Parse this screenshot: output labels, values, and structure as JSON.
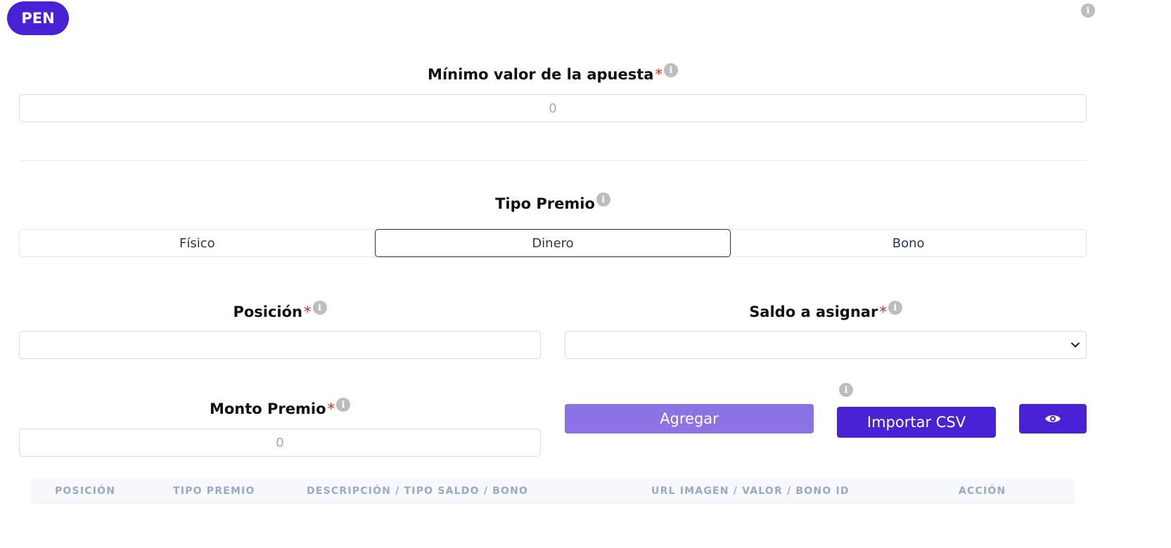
{
  "currency_badge": "PEN",
  "min_bet": {
    "label": "Mínimo valor de la apuesta",
    "required_mark": "*",
    "value_placeholder": "0"
  },
  "prize_type": {
    "label": "Tipo Premio",
    "options": [
      "Físico",
      "Dinero",
      "Bono"
    ],
    "selected": "Dinero"
  },
  "position": {
    "label": "Posición",
    "required_mark": "*",
    "value": ""
  },
  "balance": {
    "label": "Saldo a asignar",
    "required_mark": "*",
    "selected": ""
  },
  "prize_amount": {
    "label": "Monto Premio",
    "required_mark": "*",
    "value_placeholder": "0"
  },
  "actions": {
    "add_label": "Agregar",
    "import_label": "Importar CSV",
    "view_icon": "eye-icon"
  },
  "table": {
    "columns": [
      "POSICIÓN",
      "TIPO PREMIO",
      "DESCRIPCIÓN / TIPO SALDO / BONO",
      "URL IMAGEN / VALOR / BONO ID",
      "ACCIÓN"
    ]
  },
  "colors": {
    "primary": "#4a22d6",
    "primary_light": "#8b73e6",
    "required": "#e02424",
    "info_icon": "#bdbdbd"
  }
}
